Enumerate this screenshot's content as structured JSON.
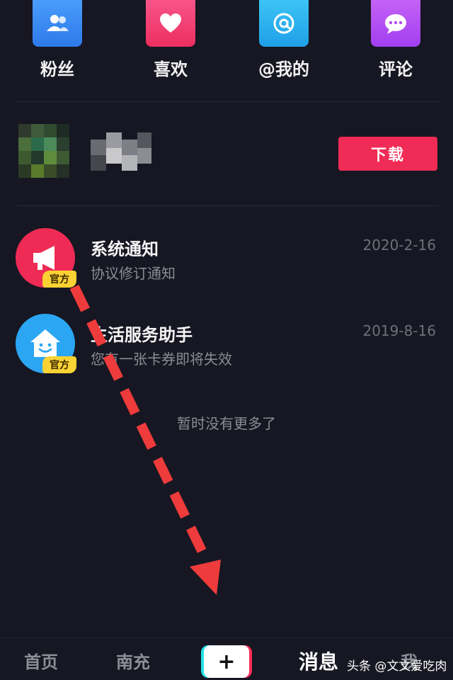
{
  "quick_entries": [
    {
      "label": "粉丝",
      "icon": "fans-icon",
      "color": "#3a8ef7"
    },
    {
      "label": "喜欢",
      "icon": "heart-icon",
      "color": "#f3416d"
    },
    {
      "label": "@我的",
      "icon": "at-icon",
      "color": "#2cb4f0"
    },
    {
      "label": "评论",
      "icon": "comment-icon",
      "color": "#b54cf2"
    }
  ],
  "ad": {
    "download_label": "下载"
  },
  "messages": [
    {
      "title": "系统通知",
      "subtitle": "协议修订通知",
      "date": "2020-2-16",
      "tag": "官方",
      "icon": "megaphone-icon",
      "color": "#ef2b55"
    },
    {
      "title": "生活服务助手",
      "subtitle": "您有一张卡券即将失效",
      "date": "2019-8-16",
      "tag": "官方",
      "icon": "smile-house-icon",
      "color": "#2ba6f3"
    }
  ],
  "list_end_text": "暂时没有更多了",
  "tab_bar": {
    "home": "首页",
    "second": "南充",
    "plus": "+",
    "messages": "消息",
    "me": "我"
  },
  "watermark": "头条 @文文爱吃肉"
}
